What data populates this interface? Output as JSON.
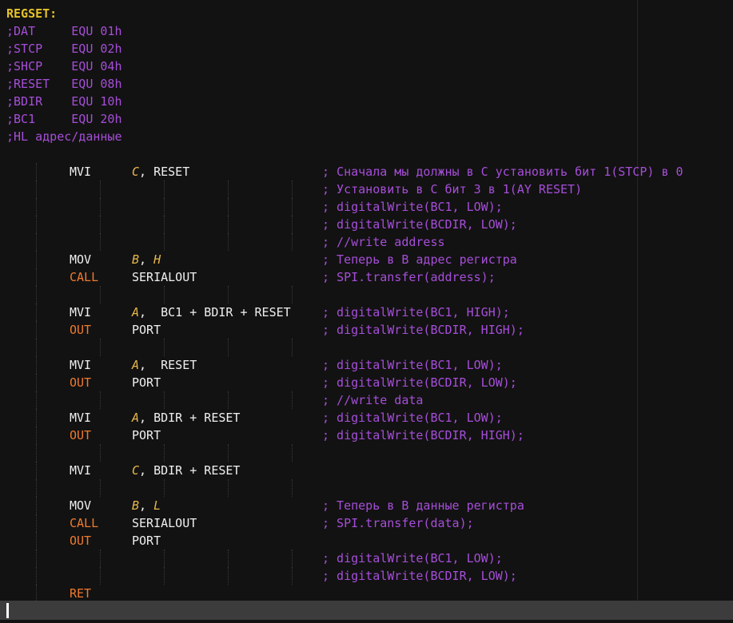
{
  "editor": {
    "lines": [
      {
        "type": "label",
        "text": "REGSET:"
      },
      {
        "type": "hcomment",
        "text": ";DAT     EQU 01h"
      },
      {
        "type": "hcomment",
        "text": ";STCP    EQU 02h"
      },
      {
        "type": "hcomment",
        "text": ";SHCP    EQU 04h"
      },
      {
        "type": "hcomment",
        "text": ";RESET   EQU 08h"
      },
      {
        "type": "hcomment",
        "text": ";BDIR    EQU 10h"
      },
      {
        "type": "hcomment",
        "text": ";BC1     EQU 20h"
      },
      {
        "type": "hcomment",
        "text": ";HL адрес/данные"
      },
      {
        "type": "blank"
      },
      {
        "type": "code",
        "mn": "MVI",
        "kw": false,
        "reg": "C",
        "rest": ", RESET",
        "comment": "; Сначала мы должны в C установить бит 1(STCP) в 0"
      },
      {
        "type": "code",
        "comment": "; Установить в C бит 3 в 1(AY RESET)"
      },
      {
        "type": "code",
        "comment": "; digitalWrite(BC1, LOW);"
      },
      {
        "type": "code",
        "comment": "; digitalWrite(BCDIR, LOW);"
      },
      {
        "type": "code",
        "comment": "; //write address"
      },
      {
        "type": "code",
        "mn": "MOV",
        "kw": false,
        "reg": "B",
        "rest": ", ",
        "reg2": "H",
        "comment": "; Теперь в B адрес регистра"
      },
      {
        "type": "code",
        "mn": "CALL",
        "kw": true,
        "op": "SERIALOUT",
        "comment": "; SPI.transfer(address);"
      },
      {
        "type": "code"
      },
      {
        "type": "code",
        "mn": "MVI",
        "kw": false,
        "reg": "A",
        "rest": ",  BC1 + BDIR + RESET",
        "comment": "; digitalWrite(BC1, HIGH);"
      },
      {
        "type": "code",
        "mn": "OUT",
        "kw": true,
        "op": "PORT",
        "comment": "; digitalWrite(BCDIR, HIGH);"
      },
      {
        "type": "code"
      },
      {
        "type": "code",
        "mn": "MVI",
        "kw": false,
        "reg": "A",
        "rest": ",  RESET",
        "comment": "; digitalWrite(BC1, LOW);"
      },
      {
        "type": "code",
        "mn": "OUT",
        "kw": true,
        "op": "PORT",
        "comment": "; digitalWrite(BCDIR, LOW);"
      },
      {
        "type": "code",
        "comment": "; //write data"
      },
      {
        "type": "code",
        "mn": "MVI",
        "kw": false,
        "reg": "A",
        "rest": ", BDIR + RESET",
        "comment": "; digitalWrite(BC1, LOW);"
      },
      {
        "type": "code",
        "mn": "OUT",
        "kw": true,
        "op": "PORT",
        "comment": "; digitalWrite(BCDIR, HIGH);"
      },
      {
        "type": "code"
      },
      {
        "type": "code",
        "mn": "MVI",
        "kw": false,
        "reg": "C",
        "rest": ", BDIR + RESET"
      },
      {
        "type": "code"
      },
      {
        "type": "code",
        "mn": "MOV",
        "kw": false,
        "reg": "B",
        "rest": ", ",
        "reg2": "L",
        "comment": "; Теперь в B данные регистра"
      },
      {
        "type": "code",
        "mn": "CALL",
        "kw": true,
        "op": "SERIALOUT",
        "comment": "; SPI.transfer(data);"
      },
      {
        "type": "code",
        "mn": "OUT",
        "kw": true,
        "op": "PORT"
      },
      {
        "type": "code",
        "comment": "; digitalWrite(BC1, LOW);"
      },
      {
        "type": "code",
        "comment": "; digitalWrite(BCDIR, LOW);"
      },
      {
        "type": "code",
        "mn": "RET",
        "kw": true
      }
    ]
  }
}
